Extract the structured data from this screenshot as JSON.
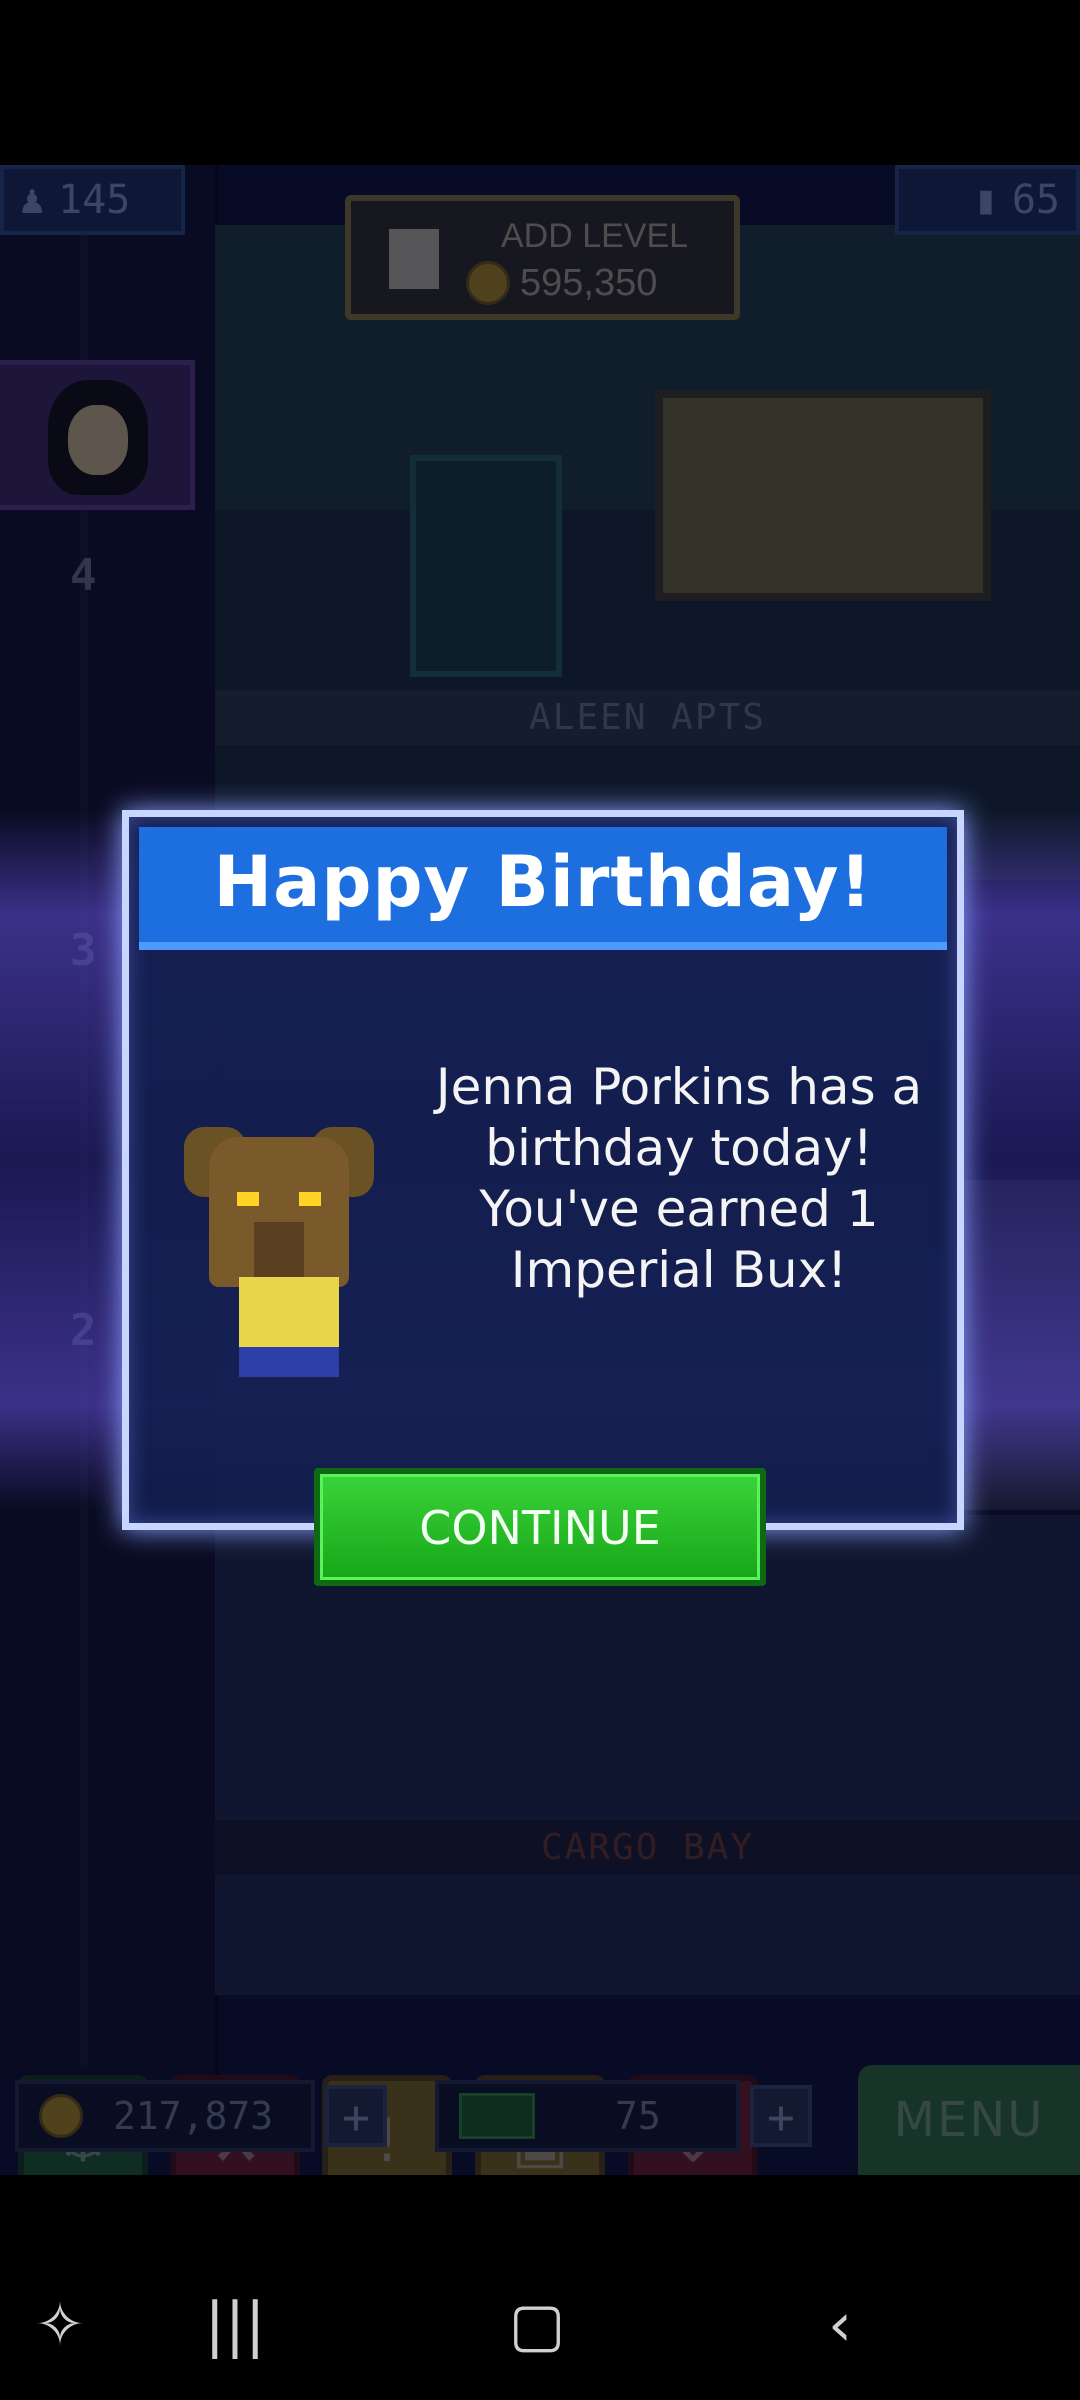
{
  "hud": {
    "population": "145",
    "floors": "65",
    "add_level_label": "ADD LEVEL",
    "add_level_cost": "595,350"
  },
  "building": {
    "floor_labels": [
      "ALEEN APTS",
      "CARGO BAY"
    ],
    "floor_numbers": [
      "4",
      "3",
      "2"
    ]
  },
  "dialog": {
    "title": "Happy Birthday!",
    "message": "Jenna Porkins has a birthday today! You've earned 1 Imperial Bux!",
    "continue_label": "CONTINUE"
  },
  "toolbar": {
    "coins": "217,873",
    "bux": "75",
    "plus": "+",
    "menu_label": "MENU"
  },
  "colors": {
    "header_blue": "#1d6fe0",
    "continue_green": "#17a517"
  }
}
